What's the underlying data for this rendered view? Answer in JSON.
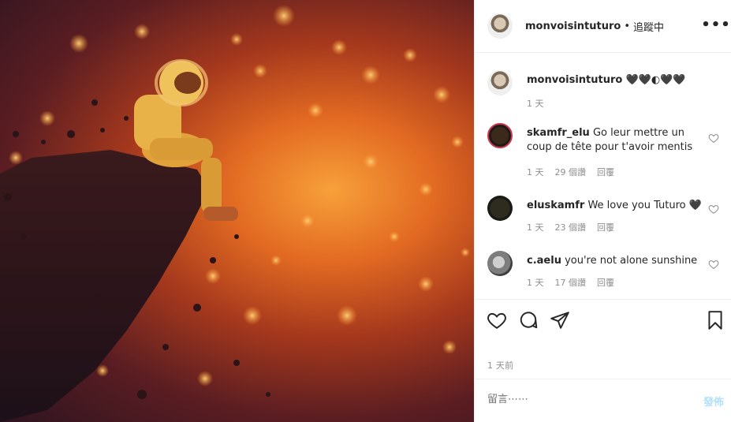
{
  "post": {
    "owner": "monvoisintuturo",
    "follow_status": "追蹤中",
    "separator": "•",
    "more_label": "•••",
    "caption": "🖤🖤◐🖤🖤",
    "caption_time": "1 天",
    "posted_ago": "1 天前"
  },
  "comments": [
    {
      "user": "skamfr_elu",
      "text": "Go leur mettre un coup de tête pour t'avoir mentis",
      "time": "1 天",
      "likes": "29 個讚",
      "reply": "回覆"
    },
    {
      "user": "eluskamfr",
      "text": "We love you Tuturo 🖤",
      "time": "1 天",
      "likes": "23 個讚",
      "reply": "回覆"
    },
    {
      "user": "c.aelu",
      "text": "you're not alone sunshine",
      "time": "1 天",
      "likes": "17 個讚",
      "reply": "回覆"
    }
  ],
  "composer": {
    "placeholder": "留言⋯⋯",
    "post_label": "發佈"
  },
  "icons": {
    "like": "heart-icon",
    "comment": "comment-icon",
    "share": "paper-plane-icon",
    "save": "bookmark-icon"
  }
}
